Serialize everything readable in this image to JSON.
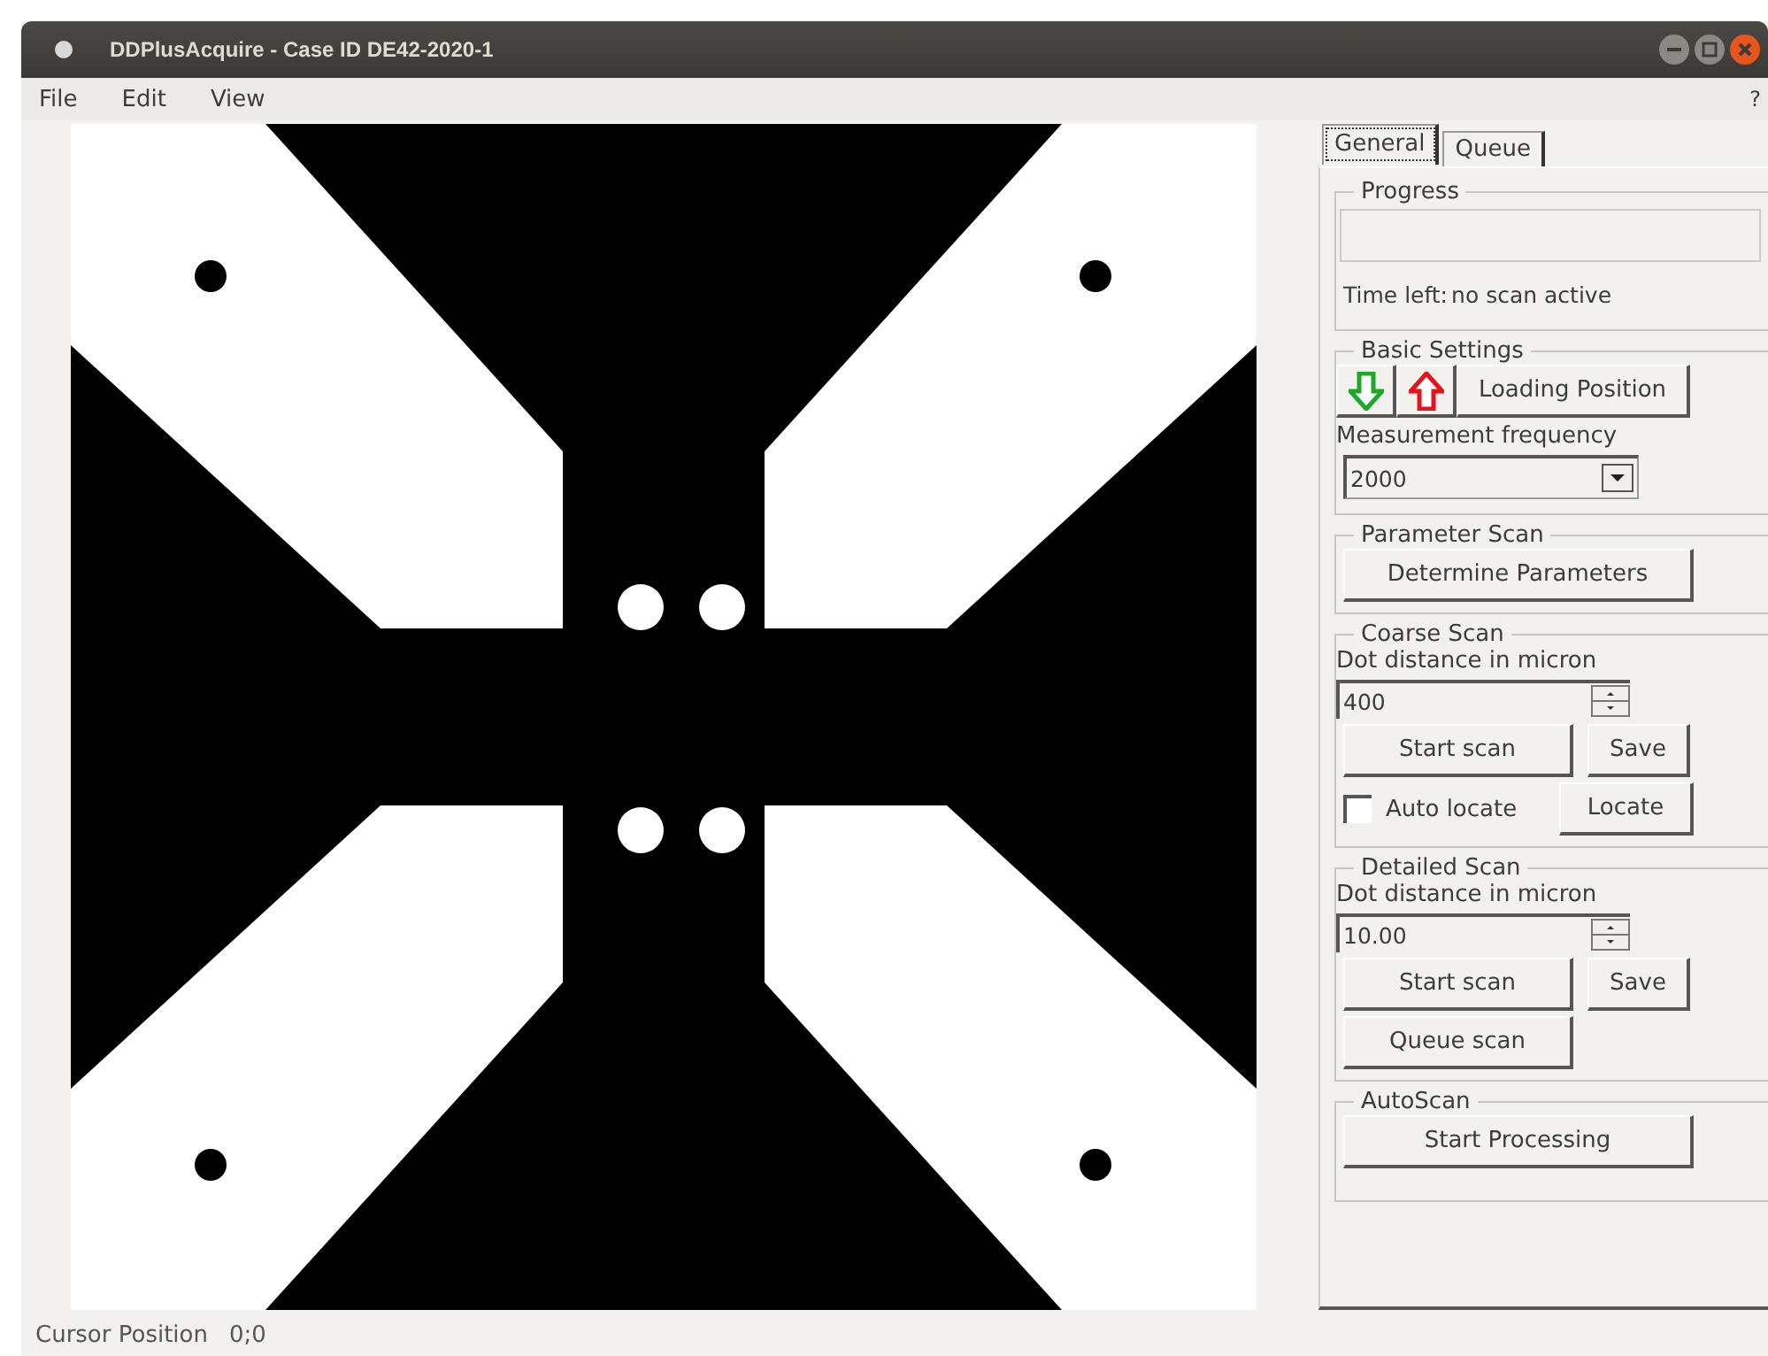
{
  "window": {
    "title": "DDPlusAcquire - Case ID DE42-2020-1"
  },
  "menu": [
    "File",
    "Edit",
    "View"
  ],
  "help": "?",
  "tabs": [
    {
      "label": "General",
      "selected": true
    },
    {
      "label": "Queue",
      "selected": false
    }
  ],
  "progress": {
    "title": "Progress",
    "level": 0,
    "time_left_label": "Time left:",
    "time_left_value": "no scan active"
  },
  "basic_settings": {
    "title": "Basic Settings",
    "loading_button": "Loading Position",
    "frequency_label": "Measurement frequency",
    "frequency_value": "2000"
  },
  "parameter_scan": {
    "title": "Parameter Scan",
    "button": "Determine Parameters"
  },
  "coarse_scan": {
    "title": "Coarse Scan",
    "distance_label": "Dot distance in micron",
    "distance_value": "400",
    "start_button": "Start scan",
    "save_button": "Save",
    "auto_locate": {
      "label": "Auto locate",
      "checked": false
    },
    "locate_button": "Locate"
  },
  "detailed_scan": {
    "title": "Detailed Scan",
    "distance_label": "Dot distance in micron",
    "distance_value": "10.00",
    "start_button": "Start scan",
    "save_button": "Save",
    "queue_button": "Queue scan"
  },
  "autoscan": {
    "title": "AutoScan",
    "button": "Start Processing"
  },
  "status_bar": {
    "label": "Cursor Position",
    "value": "0;0"
  }
}
